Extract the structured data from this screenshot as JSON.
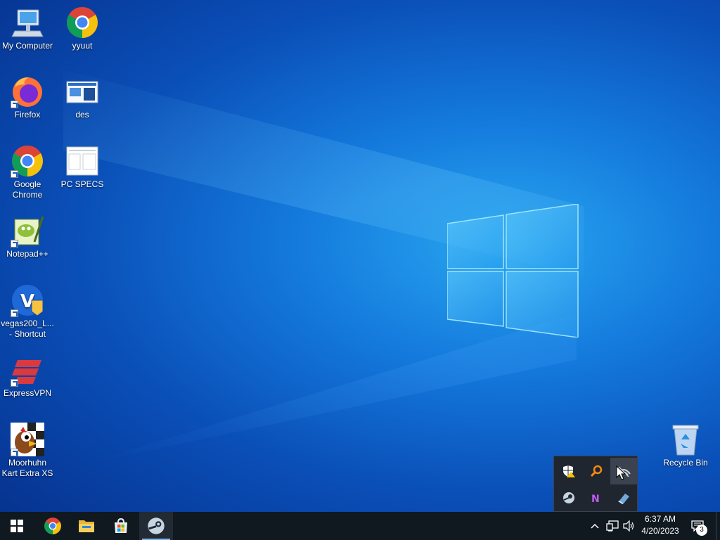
{
  "desktop": {
    "icons": [
      {
        "label": "My Computer",
        "icon": "computer-icon"
      },
      {
        "label": "yyuut",
        "icon": "chrome-icon"
      },
      {
        "label": "Firefox",
        "icon": "firefox-icon"
      },
      {
        "label": "des",
        "icon": "document-icon"
      },
      {
        "label": "Google Chrome",
        "icon": "chrome-icon"
      },
      {
        "label": "PC SPECS",
        "icon": "document-icon"
      },
      {
        "label": "Notepad++",
        "icon": "notepadpp-icon"
      },
      {
        "label": "vegas200_L... - Shortcut",
        "icon": "vegas-icon"
      },
      {
        "label": "ExpressVPN",
        "icon": "expressvpn-icon"
      },
      {
        "label": "Moorhuhn Kart Extra XS",
        "icon": "moorhuhn-icon"
      },
      {
        "label": "Recycle Bin",
        "icon": "recycle-bin-icon"
      }
    ]
  },
  "tray_flyout": {
    "items": [
      "defender-warning-icon",
      "search-tool-icon",
      "network-tool-icon",
      "steam-icon",
      "onenote-icon",
      "usb-eject-icon"
    ]
  },
  "taskbar": {
    "pinned": [
      "start-icon",
      "chrome-icon",
      "file-explorer-icon",
      "microsoft-store-icon",
      "steam-icon"
    ],
    "clock": {
      "time": "6:37 AM",
      "date": "4/20/2023"
    },
    "notification_count": "3",
    "colors": {
      "taskbar_bg": "#101820",
      "accent": "#0078d7"
    }
  }
}
